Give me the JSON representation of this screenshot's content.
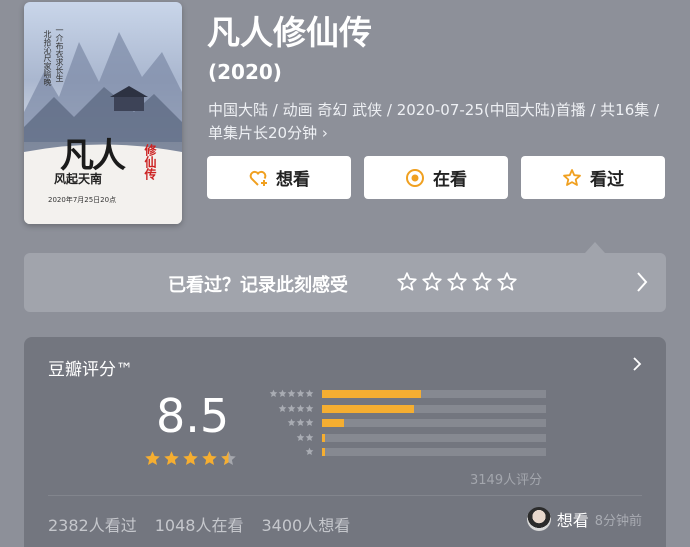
{
  "poster": {
    "title_art": "凡人",
    "subtitle_art": "风起天南",
    "side_art": "修仙传",
    "date_art": "2020年7月25日20点",
    "tag_art_1": "北拾沁尺家喻晚",
    "tag_art_2": "一介布衣求长生"
  },
  "movie": {
    "title": "凡人修仙传",
    "year": "(2020)",
    "meta": "中国大陆 / 动画 奇幻 武侠 / 2020-07-25(中国大陆)首播 / 共16集 / 单集片长20分钟 ›"
  },
  "actions": {
    "want": "想看",
    "watching": "在看",
    "watched": "看过"
  },
  "rate_prompt": {
    "text": "已看过？记录此刻感受",
    "star_count": 5
  },
  "rating": {
    "header": "豆瓣评分™",
    "score": "8.5",
    "stars_value": 4.5,
    "distribution": [
      {
        "stars": 5,
        "percent": 44
      },
      {
        "stars": 4,
        "percent": 41
      },
      {
        "stars": 3,
        "percent": 10
      },
      {
        "stars": 2,
        "percent": 1.5
      },
      {
        "stars": 1,
        "percent": 1.5
      }
    ],
    "count_text": "3149人评分"
  },
  "stats": {
    "watched": "2382人看过",
    "watching": "1048人在看",
    "want": "3400人想看"
  },
  "friend_activity": {
    "action": "想看",
    "time": "8分钟前"
  },
  "colors": {
    "accent": "#f5ae31",
    "button_icon": "#f0a020",
    "page_bg": "#8d9099",
    "card_bg": "#73767f"
  }
}
